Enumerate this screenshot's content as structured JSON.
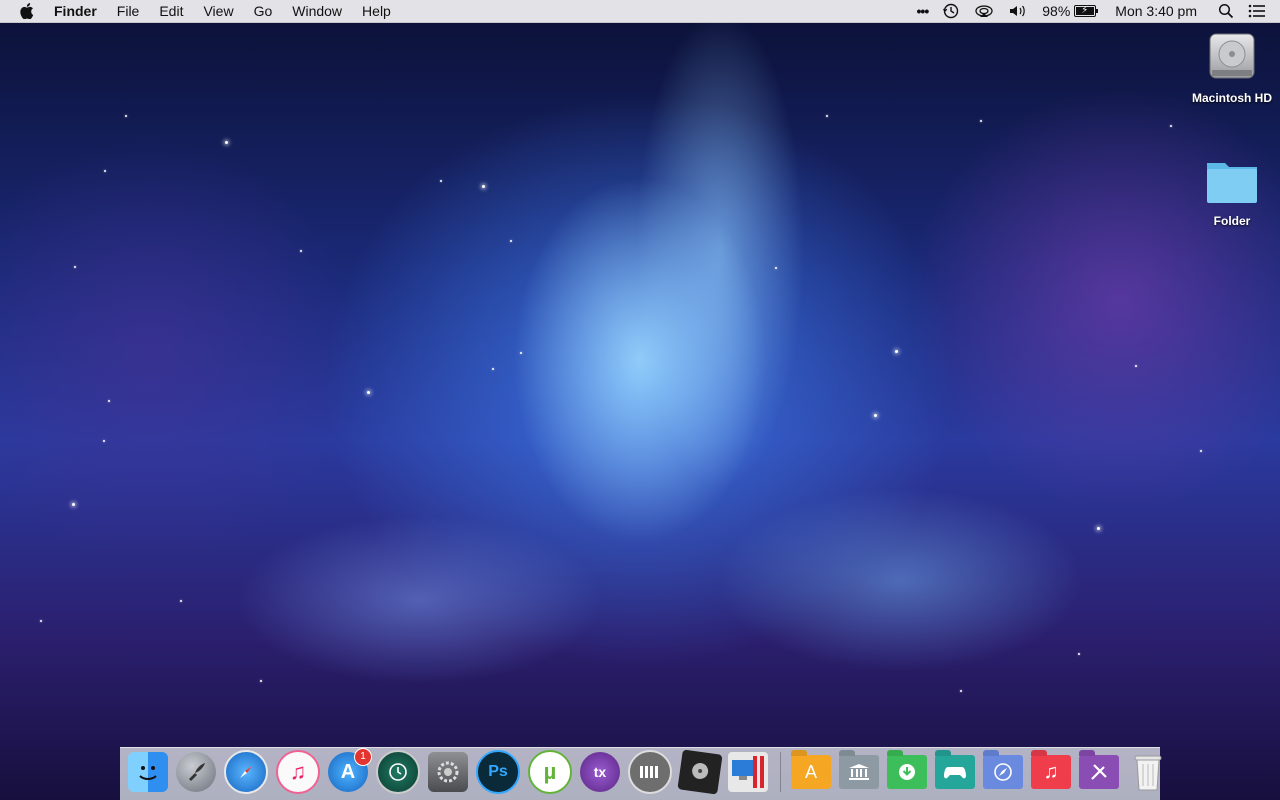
{
  "menubar": {
    "app_name": "Finder",
    "menus": [
      "File",
      "Edit",
      "View",
      "Go",
      "Window",
      "Help"
    ],
    "status": {
      "more": "•••",
      "battery_percent": "98%",
      "battery_level": 0.98,
      "clock": "Mon 3:40 pm"
    }
  },
  "desktop": {
    "icons": [
      {
        "label": "Macintosh HD",
        "icon": "hard-drive-icon"
      },
      {
        "label": "Folder",
        "icon": "folder-icon"
      }
    ]
  },
  "dock": {
    "apps": [
      {
        "name": "finder",
        "color": "#2f8ff0"
      },
      {
        "name": "launchpad",
        "color": "#8a8f98"
      },
      {
        "name": "safari",
        "color": "#1e88e5"
      },
      {
        "name": "itunes",
        "color": "#f0f0f5"
      },
      {
        "name": "app-store",
        "color": "#1d8ef0",
        "badge": "1"
      },
      {
        "name": "time-machine",
        "color": "#135b4a"
      },
      {
        "name": "system-preferences",
        "color": "#6d6f73"
      },
      {
        "name": "photoshop",
        "color": "#0a2a3a",
        "text": "Ps"
      },
      {
        "name": "utorrent",
        "color": "#63b33a"
      },
      {
        "name": "torbrowser",
        "color": "#7b3fa3"
      },
      {
        "name": "clipper",
        "color": "#6e6e6e"
      },
      {
        "name": "disk-utility",
        "color": "#222222"
      },
      {
        "name": "parallels",
        "color": "#2b7bd9"
      }
    ],
    "folders": [
      {
        "name": "applications-folder",
        "color": "#f5a623"
      },
      {
        "name": "library-folder",
        "color": "#8d9aa3"
      },
      {
        "name": "downloads-folder",
        "color": "#3cbf5a"
      },
      {
        "name": "games-folder",
        "color": "#25a69a"
      },
      {
        "name": "web-folder",
        "color": "#6a8ae0"
      },
      {
        "name": "music-folder",
        "color": "#ef3d4b"
      },
      {
        "name": "utilities-folder",
        "color": "#8a4db3"
      }
    ],
    "trash": {
      "name": "trash"
    }
  }
}
